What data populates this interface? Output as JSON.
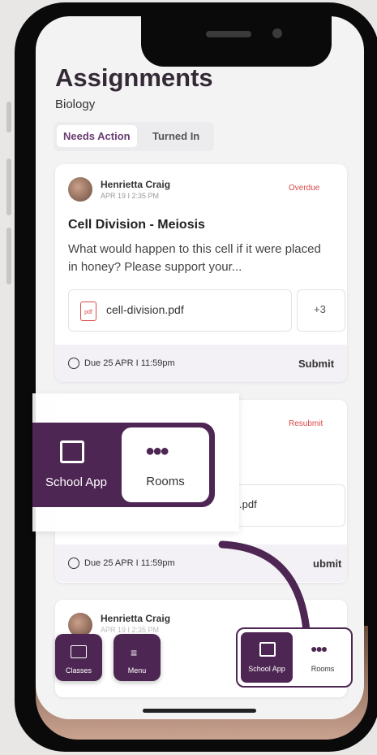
{
  "page": {
    "title": "Assignments",
    "subtitle": "Biology"
  },
  "tabs": [
    "Needs Action",
    "Turned In"
  ],
  "card1": {
    "author": "Henrietta Craig",
    "date": "APR 19 I 2:35 PM",
    "status": "Overdue",
    "title": "Cell Division - Meiosis",
    "description": "What would happen to this cell if it were placed in honey? Please support your...",
    "file_name": "cell-division.pdf",
    "file_icon_label": "pdf",
    "extra_files": "+3",
    "due": "Due 25 APR I 11:59pm",
    "action": "Submit"
  },
  "card2": {
    "status": "Resubmit",
    "file_name_partial": ".pdf",
    "due": "Due 25 APR I 11:59pm",
    "action_partial": "ubmit"
  },
  "card3": {
    "author": "Henrietta Craig",
    "date": "APR 19 I 2:35 PM"
  },
  "popup": {
    "school_app": "School App",
    "rooms": "Rooms"
  },
  "bottom_nav": {
    "classes": "Classes",
    "menu": "Menu",
    "school_app": "School App",
    "rooms": "Rooms"
  },
  "colors": {
    "brand": "#4e2653",
    "overdue": "#d94a4a"
  }
}
